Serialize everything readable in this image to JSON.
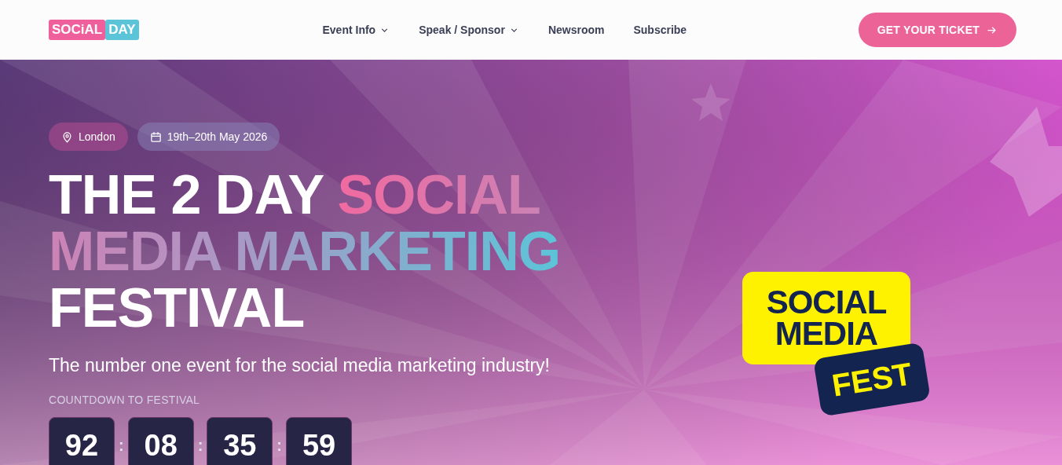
{
  "header": {
    "logo": {
      "left": "SOCiAL",
      "right": "DAY"
    },
    "nav": [
      {
        "label": "Event Info",
        "dropdown": true
      },
      {
        "label": "Speak / Sponsor",
        "dropdown": true
      },
      {
        "label": "Newsroom",
        "dropdown": false
      },
      {
        "label": "Subscribe",
        "dropdown": false
      }
    ],
    "cta": {
      "label": "GET YOUR TICKET"
    }
  },
  "hero": {
    "tags": [
      {
        "kind": "location",
        "label": "London"
      },
      {
        "kind": "date",
        "label": "19th–20th May 2026"
      }
    ],
    "headline": [
      {
        "text": "THE 2 DAY ",
        "kind": "plain"
      },
      {
        "text": "SOCIAL MEDIA MARKETING",
        "kind": "gradient"
      },
      {
        "text": " FESTIVAL",
        "kind": "plain"
      }
    ],
    "subtitle": "The number one event for the social media marketing industry!",
    "countdown_label": "COUNTDOWN TO FESTIVAL",
    "countdown": [
      "92",
      "08",
      "35",
      "59"
    ],
    "separator": ":",
    "badge": {
      "top_line_1": "SOCIAL",
      "top_line_2": "MEDIA",
      "bottom": "FEST"
    }
  }
}
